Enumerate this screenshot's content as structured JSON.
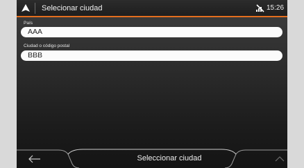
{
  "header": {
    "title": "Selecionar ciudad",
    "time": "15:26",
    "logo_icon": "navigation-arrow-icon",
    "status_icon": "no-signal-icon"
  },
  "form": {
    "country_label": "País",
    "country_value": "AAA",
    "city_label": "Ciudad o código postal",
    "city_value": "BBB"
  },
  "bottom": {
    "back_icon": "arrow-left-icon",
    "action_label": "Seleccionar ciudad",
    "up_icon": "chevron-up-icon"
  },
  "colors": {
    "accent": "#e46e1e",
    "field_bg": "#fbfbfb",
    "page_bg": "#d9d9d9"
  }
}
